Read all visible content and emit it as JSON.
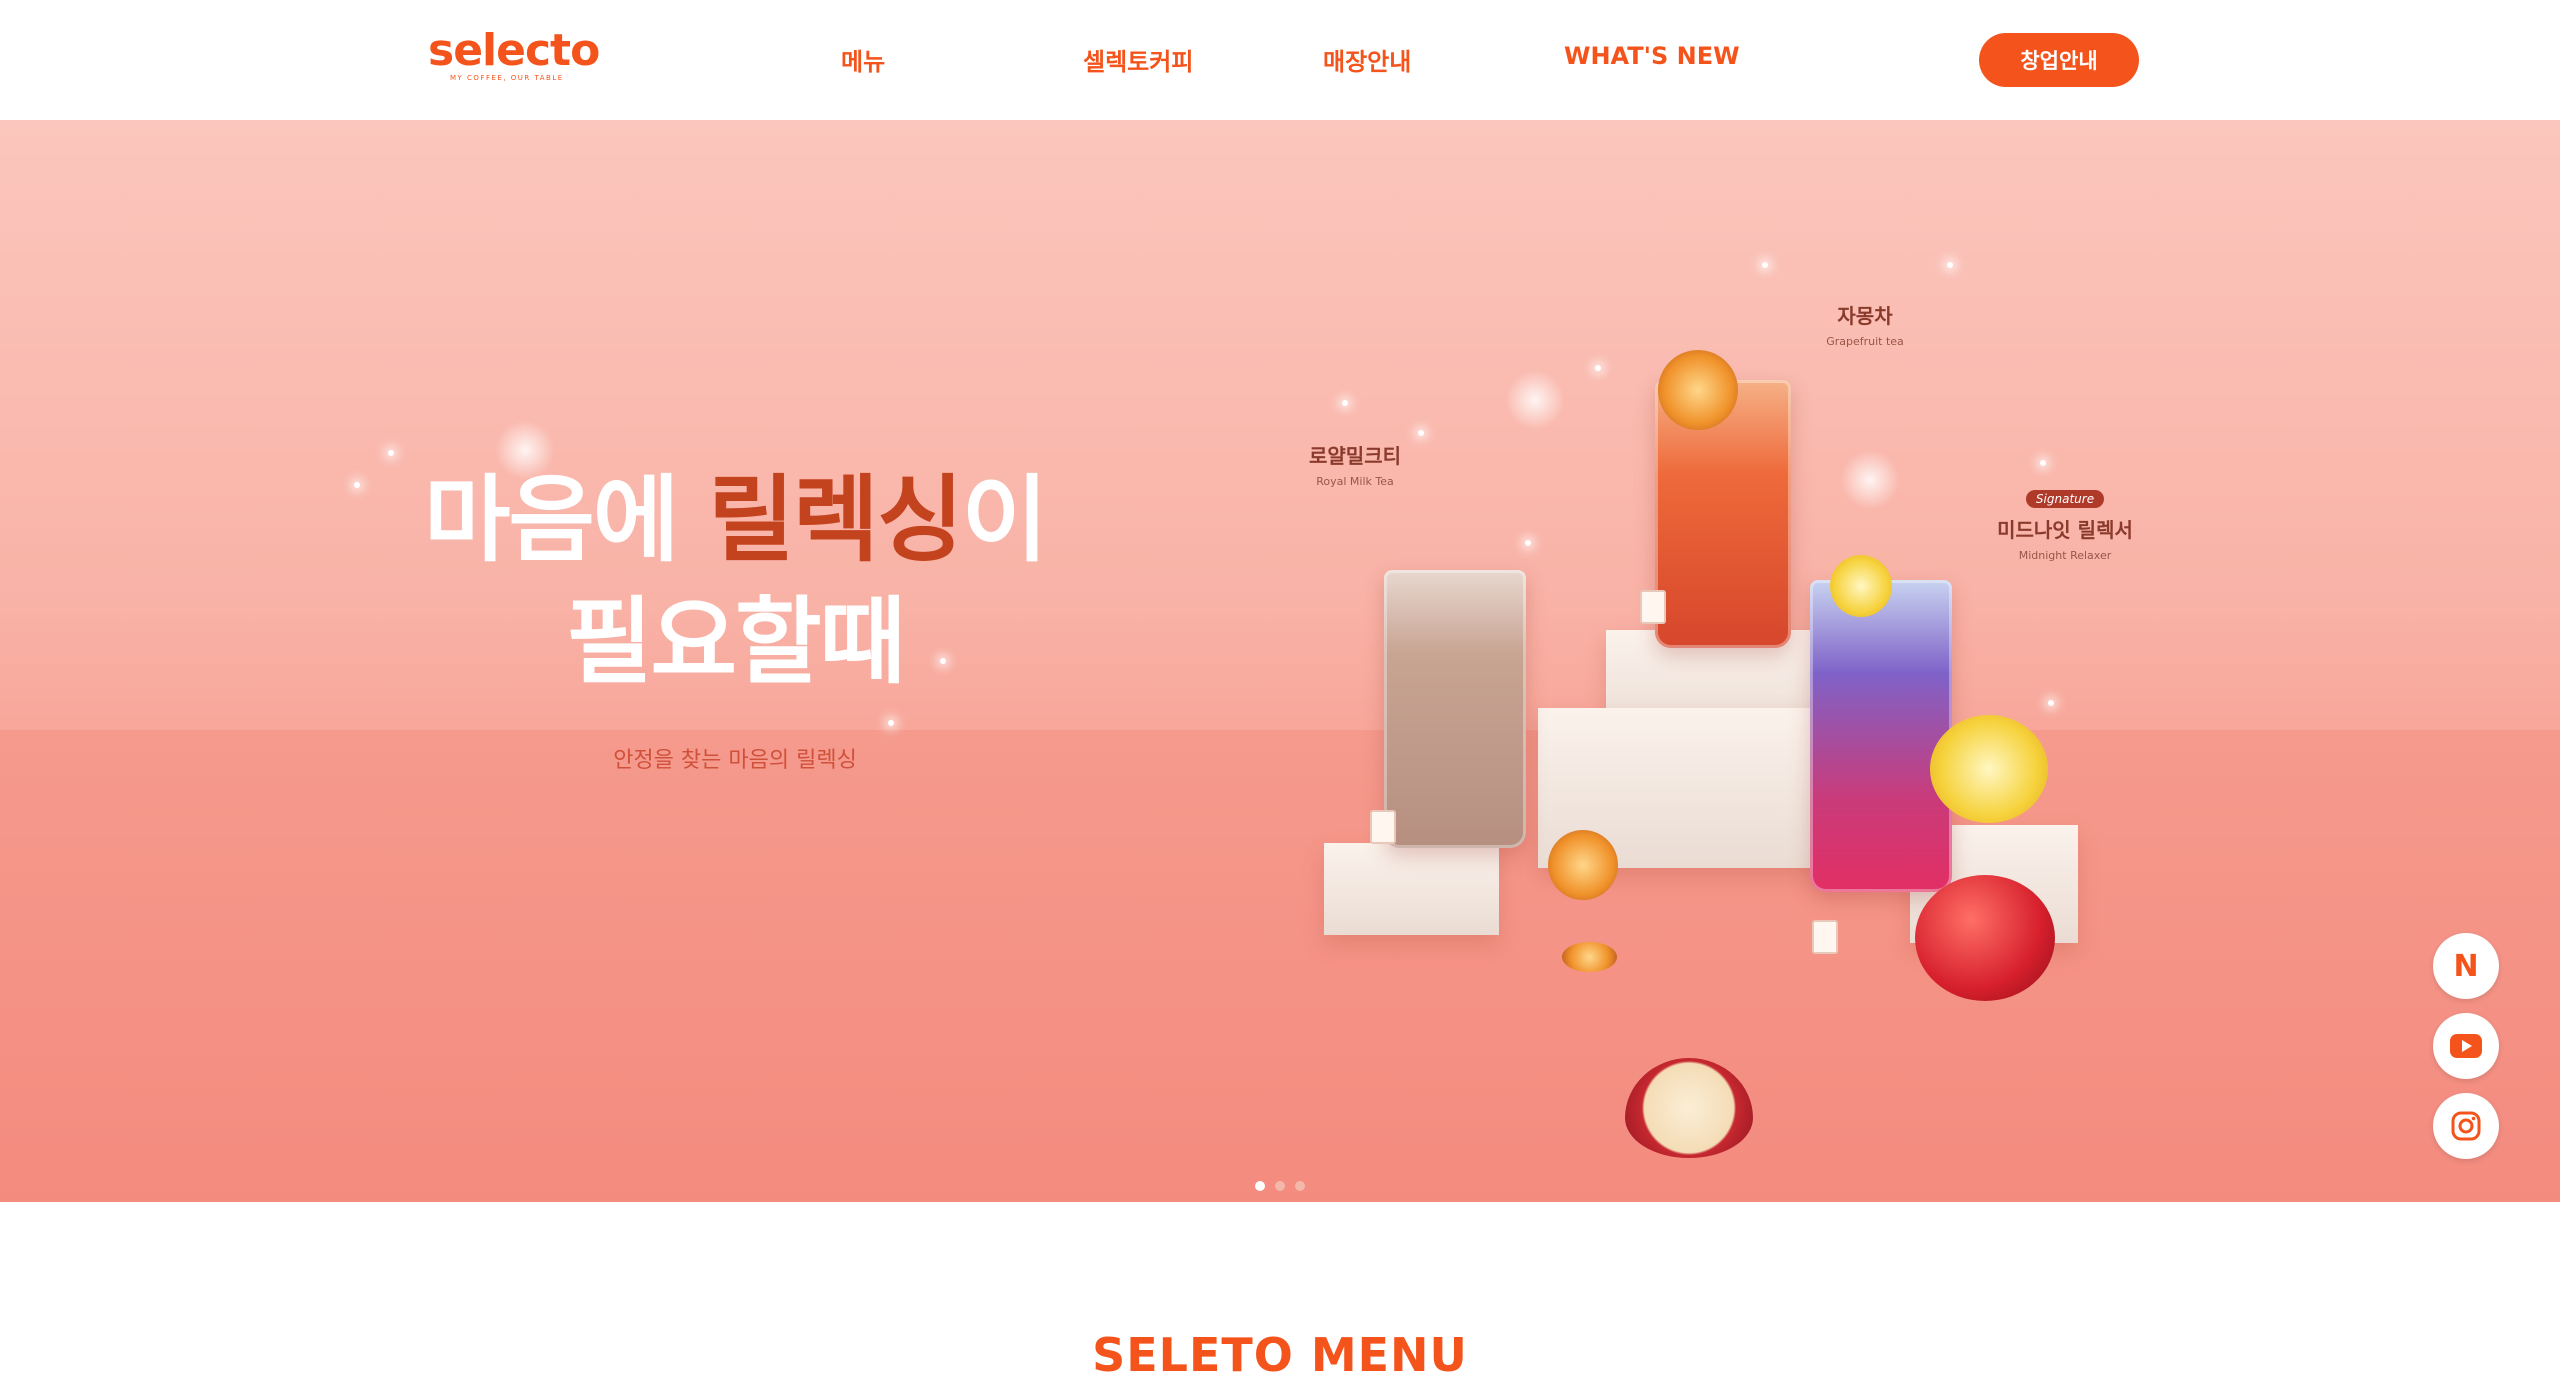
{
  "brand": {
    "name": "selecto",
    "tagline": "MY COFFEE, OUR TABLE",
    "accent_color": "#f4541c"
  },
  "nav": {
    "items": [
      {
        "label": "메뉴"
      },
      {
        "label": "셀렉토커피"
      },
      {
        "label": "매장안내"
      },
      {
        "label": "WHAT'S NEW"
      }
    ],
    "cta_label": "창업안내"
  },
  "hero": {
    "headline_part1": "마음에 ",
    "headline_accent": "릴렉싱",
    "headline_part2": "이",
    "headline_line2": "필요할때",
    "subline": "안정을 찾는 마음의 릴렉싱",
    "drinks": [
      {
        "name_ko": "로얄밀크티",
        "name_en": "Royal Milk Tea"
      },
      {
        "name_ko": "자몽차",
        "name_en": "Grapefruit tea"
      },
      {
        "badge": "Signature",
        "name_ko": "미드나잇 릴렉서",
        "name_en": "Midnight Relaxer"
      }
    ],
    "slides": 3,
    "active_slide": 1
  },
  "social": [
    {
      "icon": "naver-blog-icon",
      "glyph": "N"
    },
    {
      "icon": "youtube-icon"
    },
    {
      "icon": "instagram-icon"
    }
  ],
  "section": {
    "title": "SELETO MENU"
  }
}
